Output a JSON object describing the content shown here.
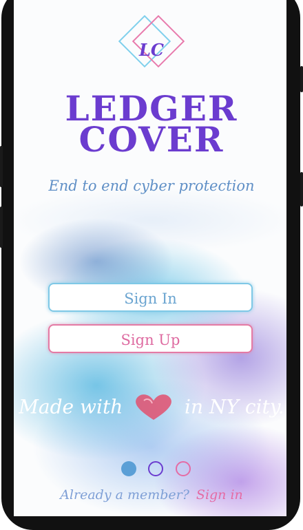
{
  "brand": {
    "logo_monogram": "LC",
    "line1": "LEDGER",
    "line2": "COVER",
    "color": "#6b3ccf"
  },
  "tagline": "End to end cyber protection",
  "buttons": {
    "sign_in": "Sign In",
    "sign_up": "Sign Up"
  },
  "made_with": {
    "prefix": "Made with",
    "suffix": "in NY city.",
    "heart_icon": "heart-icon"
  },
  "pager": {
    "count": 3,
    "active_index": 0,
    "colors": [
      "#5b9fd6",
      "#6b3ccf",
      "#e56ba4"
    ]
  },
  "footer": {
    "question": "Already a member?",
    "link": "Sign in"
  }
}
